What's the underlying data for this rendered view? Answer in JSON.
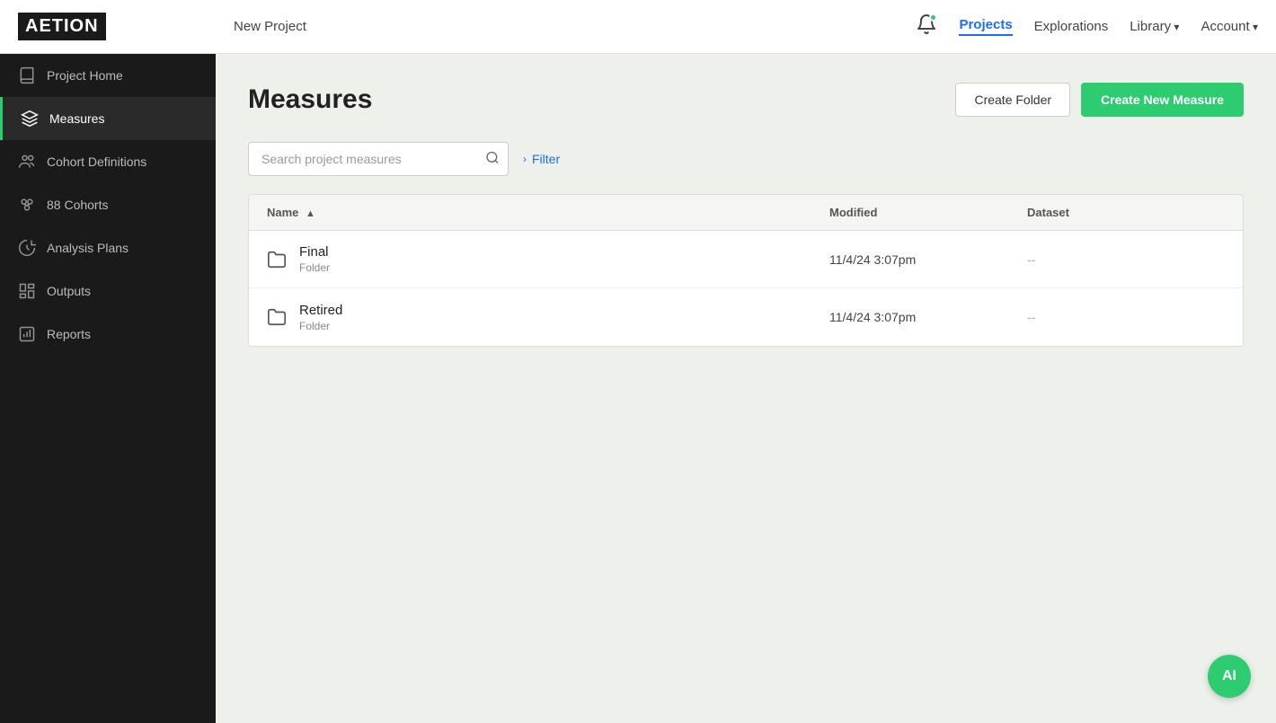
{
  "brand": {
    "logo": "AETION"
  },
  "topnav": {
    "project_name": "New Project",
    "links": [
      {
        "id": "projects",
        "label": "Projects",
        "active": true,
        "dropdown": false
      },
      {
        "id": "explorations",
        "label": "Explorations",
        "active": false,
        "dropdown": false
      },
      {
        "id": "library",
        "label": "Library",
        "active": false,
        "dropdown": true
      },
      {
        "id": "account",
        "label": "Account",
        "active": false,
        "dropdown": true
      }
    ]
  },
  "sidebar": {
    "items": [
      {
        "id": "project-home",
        "label": "Project Home",
        "active": false
      },
      {
        "id": "measures",
        "label": "Measures",
        "active": true
      },
      {
        "id": "cohort-definitions",
        "label": "Cohort Definitions",
        "active": false
      },
      {
        "id": "cohorts",
        "label": "88 Cohorts",
        "active": false
      },
      {
        "id": "analysis-plans",
        "label": "Analysis Plans",
        "active": false
      },
      {
        "id": "outputs",
        "label": "Outputs",
        "active": false
      },
      {
        "id": "reports",
        "label": "Reports",
        "active": false
      }
    ]
  },
  "page": {
    "title": "Measures",
    "create_folder_label": "Create Folder",
    "create_measure_label": "Create New Measure"
  },
  "search": {
    "placeholder": "Search project measures"
  },
  "filter": {
    "label": "Filter"
  },
  "table": {
    "columns": [
      "Name",
      "Modified",
      "Dataset"
    ],
    "sort_col": "Name",
    "rows": [
      {
        "id": "final",
        "name": "Final",
        "type": "Folder",
        "modified": "11/4/24 3:07pm",
        "dataset": "--"
      },
      {
        "id": "retired",
        "name": "Retired",
        "type": "Folder",
        "modified": "11/4/24 3:07pm",
        "dataset": "--"
      }
    ]
  },
  "ai_badge": {
    "label": "AI"
  }
}
